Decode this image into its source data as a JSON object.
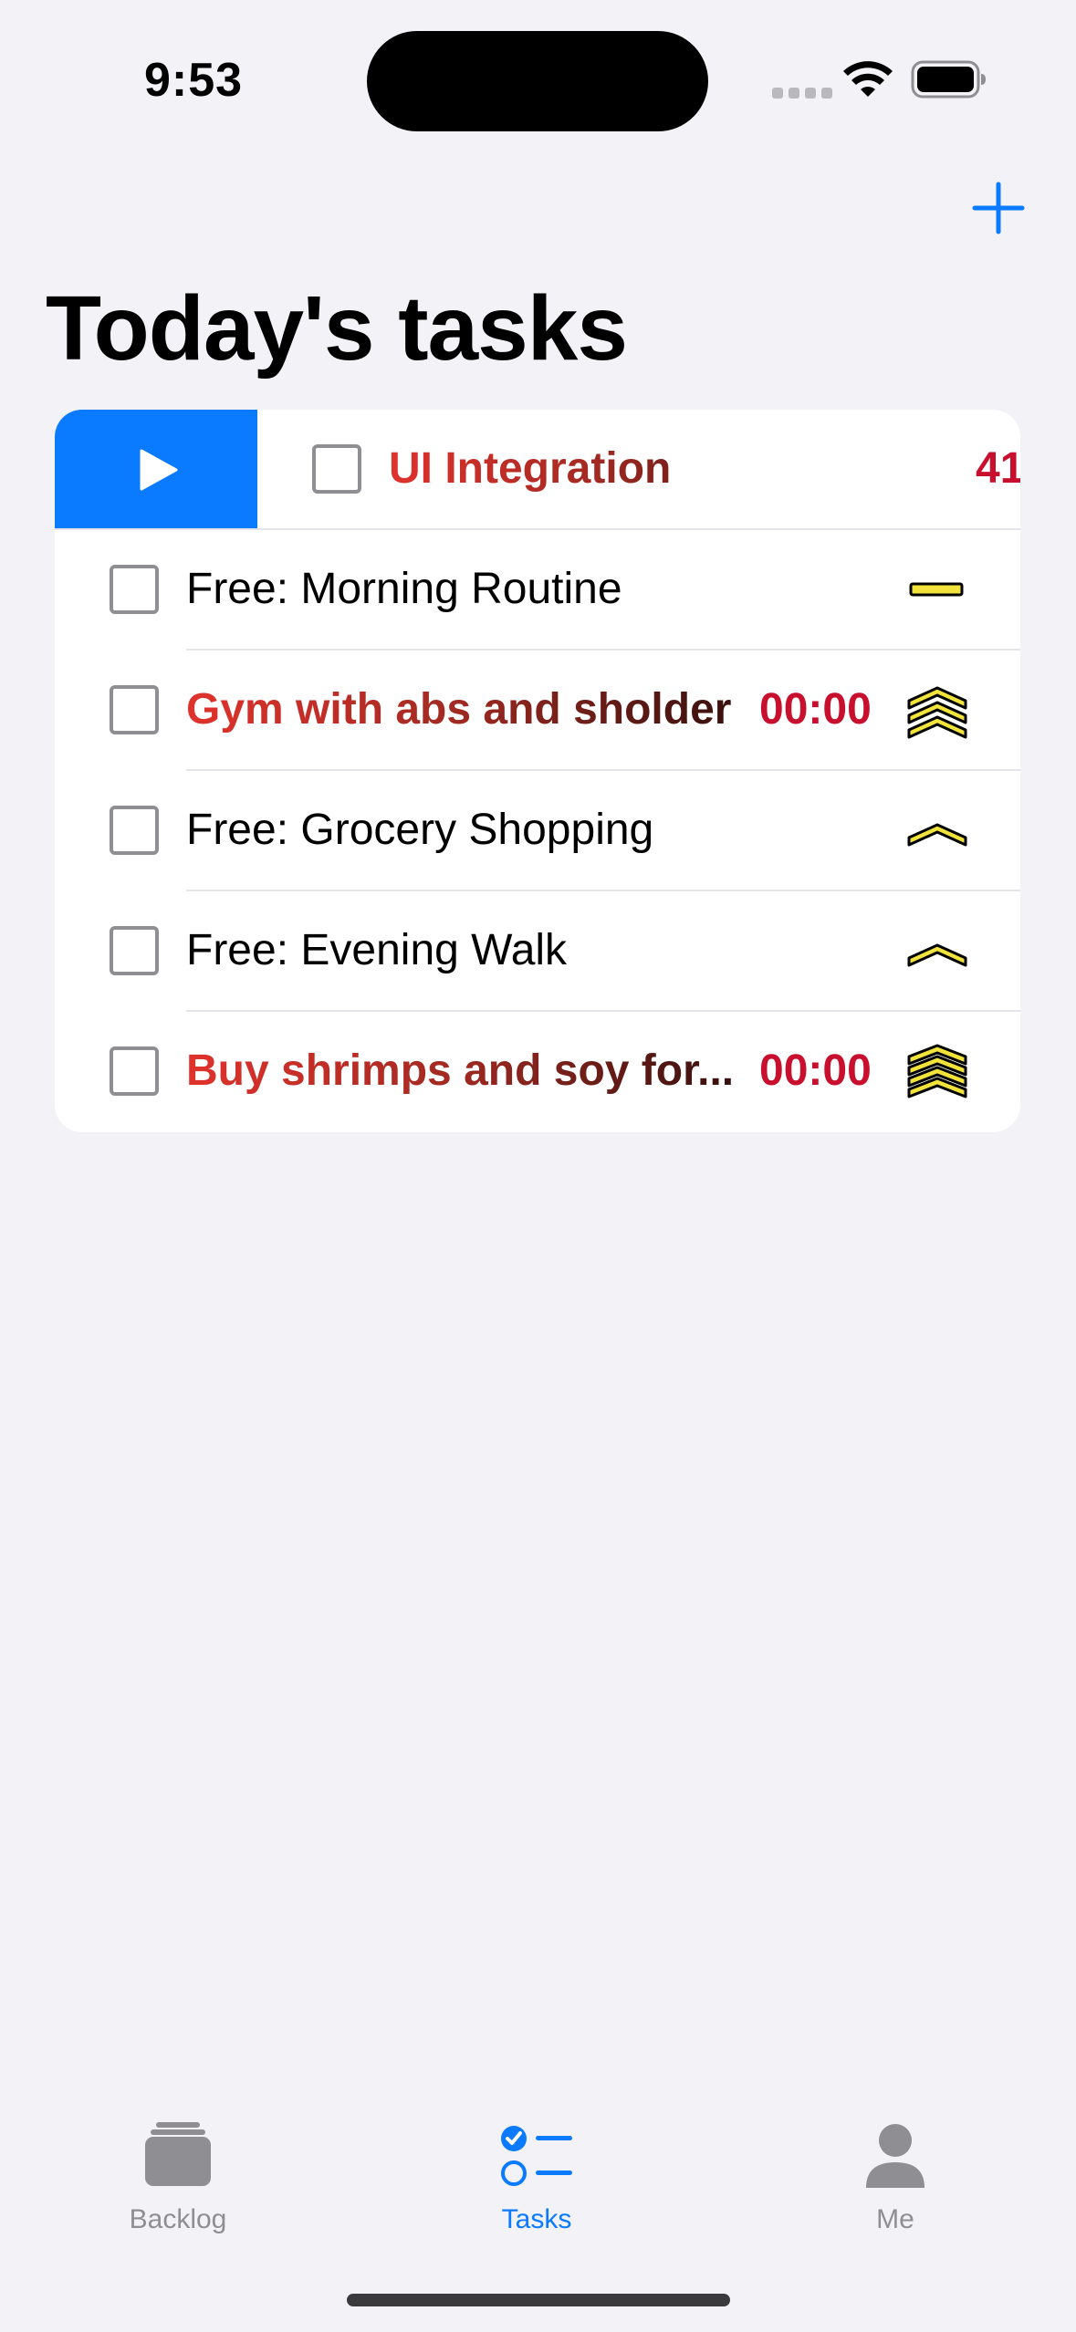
{
  "status_bar": {
    "time": "9:53",
    "icons": [
      "cellular-signal-icon",
      "wifi-icon",
      "battery-icon"
    ]
  },
  "header": {
    "title": "Today's tasks",
    "add_icon": "plus-icon"
  },
  "active_task": {
    "title": "UI Integration",
    "timer": "41"
  },
  "tasks": [
    {
      "title": "Free: Morning Routine",
      "timer": "",
      "style": "free",
      "priority": "medium"
    },
    {
      "title": "Gym with abs and sholder",
      "timer": "00:00",
      "style": "urgent",
      "priority": "very-high"
    },
    {
      "title": "Free: Grocery Shopping",
      "timer": "",
      "style": "free",
      "priority": "high"
    },
    {
      "title": "Free: Evening Walk",
      "timer": "",
      "style": "free",
      "priority": "high"
    },
    {
      "title": "Buy shrimps and soy for...",
      "timer": "00:00",
      "style": "urgent",
      "priority": "highest"
    }
  ],
  "tab_bar": {
    "tabs": [
      {
        "label": "Backlog",
        "icon": "tray-stack-icon",
        "selected": false
      },
      {
        "label": "Tasks",
        "icon": "checklist-icon",
        "selected": true
      },
      {
        "label": "Me",
        "icon": "person-icon",
        "selected": false
      }
    ]
  },
  "colors": {
    "background": "#f2f2f7",
    "accent": "#0a7aff",
    "timer": "#c8102e",
    "priority_fill": "#f2e33c",
    "tab_inactive": "#8e8e93"
  }
}
